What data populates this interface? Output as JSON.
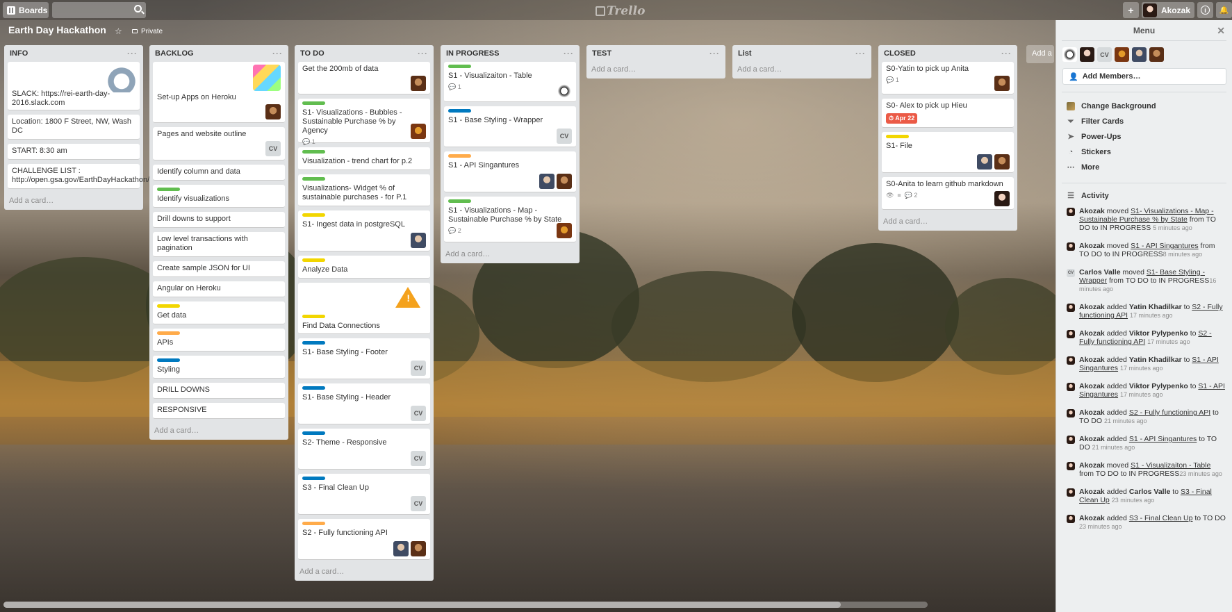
{
  "header": {
    "boards_label": "Boards",
    "logo_text": "Trello",
    "user_name": "Akozak",
    "add_label": "+",
    "info_label": "i",
    "notif_label": "🔔"
  },
  "board": {
    "title": "Earth Day Hackathon",
    "visibility": "Private",
    "add_list_label": "Add a list…"
  },
  "lists": {
    "info": {
      "title": "INFO",
      "cards": {
        "c0": "SLACK: https://rei-earth-day-2016.slack.com",
        "c1": "Location: 1800 F Street, NW, Wash DC",
        "c2": "START: 8:30 am",
        "c3": "CHALLENGE LIST : http://open.gsa.gov/EarthDayHackathon/"
      },
      "add": "Add a card…"
    },
    "backlog": {
      "title": "BACKLOG",
      "cards": {
        "c0": "Set-up Apps on Heroku",
        "c1": "Pages and website outline",
        "c2": "Identify column and data",
        "c3": "Identify visualizations",
        "c4": "Drill downs to support",
        "c5": "Low level transactions with pagination",
        "c6": "Create sample JSON for UI",
        "c7": "Angular on Heroku",
        "c8": "Get data",
        "c9": "APIs",
        "c10": "Styling",
        "c11": "DRILL DOWNS",
        "c12": "RESPONSIVE"
      },
      "add": "Add a card…"
    },
    "todo": {
      "title": "TO DO",
      "cards": {
        "c0": "Get the 200mb of data",
        "c1": "S1- Visualizations - Bubbles - Sustainable Purchase % by Agency",
        "c1_badge": "1",
        "c2": "Visualization - trend chart for p.2",
        "c3": "Visualizations- Widget % of sustainable purchases - for P.1",
        "c4": "S1- Ingest data in postgreSQL",
        "c5": "Analyze Data",
        "c6": "Find Data Connections",
        "c7": "S1- Base Styling - Footer",
        "c8": "S1- Base Styling - Header",
        "c9": "S2- Theme - Responsive",
        "c10": "S3 - Final Clean Up",
        "c11": "S2 - Fully functioning API"
      },
      "add": "Add a card…"
    },
    "inprogress": {
      "title": "IN PROGRESS",
      "cards": {
        "c0": "S1 - Visualizaiton - Table",
        "c0_badge": "1",
        "c1": "S1 - Base Styling - Wrapper",
        "c2": "S1 - API Singantures",
        "c3": "S1 - Visualizations - Map - Sustainable Purchase % by State",
        "c3_badge": "2"
      },
      "add": "Add a card…"
    },
    "test": {
      "title": "TEST",
      "add": "Add a card…"
    },
    "list": {
      "title": "List",
      "add": "Add a card…"
    },
    "closed": {
      "title": "CLOSED",
      "cards": {
        "c0": "S0-Yatin to pick up Anita",
        "c0_badge": "1",
        "c1": "S0- Alex to pick up Hieu",
        "c1_due": "Apr 22",
        "c2": "S1- File",
        "c3": "S0-Anita to learn github markdown",
        "c3_badge": "2"
      },
      "add": "Add a card…"
    }
  },
  "member_initials": "CV",
  "sidebar": {
    "title": "Menu",
    "add_members": "Add Members…",
    "menu": {
      "bg": "Change Background",
      "filter": "Filter Cards",
      "powerups": "Power-Ups",
      "stickers": "Stickers",
      "more": "More"
    },
    "activity_title": "Activity",
    "activity": [
      {
        "user": "Akozak",
        "verb": " moved ",
        "target": "S1- Visualizations - Map - Sustainable Purchase % by State",
        "rest": " from TO DO to IN PROGRESS ",
        "time": "5 minutes ago"
      },
      {
        "user": "Akozak",
        "verb": " moved ",
        "target": "S1 - API Singantures",
        "rest": " from TO DO to IN PROGRESS",
        "time": "8 minutes ago"
      },
      {
        "user": "Carlos Valle",
        "verb": " moved ",
        "target": "S1- Base Styling - Wrapper",
        "rest": " from TO DO to IN PROGRESS",
        "time": "16 minutes ago"
      },
      {
        "user": "Akozak",
        "verb": " added ",
        "target2": "Yatin Khadilkar",
        "verb2": " to ",
        "target": "S2 - Fully functioning API",
        "rest": " ",
        "time": "17 minutes ago"
      },
      {
        "user": "Akozak",
        "verb": " added ",
        "target2": "Viktor Pylypenko",
        "verb2": " to ",
        "target": "S2 - Fully functioning API",
        "rest": " ",
        "time": "17 minutes ago"
      },
      {
        "user": "Akozak",
        "verb": " added ",
        "target2": "Yatin Khadilkar",
        "verb2": " to ",
        "target": "S1 - API Singantures",
        "rest": " ",
        "time": "17 minutes ago"
      },
      {
        "user": "Akozak",
        "verb": " added ",
        "target2": "Viktor Pylypenko",
        "verb2": " to ",
        "target": "S1 - API Singantures",
        "rest": " ",
        "time": "17 minutes ago"
      },
      {
        "user": "Akozak",
        "verb": " added ",
        "target": "S2 - Fully functioning API",
        "rest": " to TO DO ",
        "time": "21 minutes ago"
      },
      {
        "user": "Akozak",
        "verb": " added ",
        "target": "S1 - API Singantures",
        "rest": " to TO DO ",
        "time": "21 minutes ago"
      },
      {
        "user": "Akozak",
        "verb": " moved ",
        "target": "S1 - Visualizaiton - Table",
        "rest": " from TO DO to IN PROGRESS",
        "time": "23 minutes ago"
      },
      {
        "user": "Akozak",
        "verb": " added ",
        "target2": "Carlos Valle",
        "verb2": " to ",
        "target": "S3 - Final Clean Up",
        "rest": " ",
        "time": "23 minutes ago"
      },
      {
        "user": "Akozak",
        "verb": " added ",
        "target": "S3 - Final Clean Up",
        "rest": " to TO DO ",
        "time": "23 minutes ago"
      }
    ]
  },
  "colors": {
    "label_green": "#61bd4f",
    "label_yellow": "#f2d600",
    "label_orange": "#ffab4a",
    "label_blue": "#0079bf",
    "due_red": "#eb5a46"
  }
}
